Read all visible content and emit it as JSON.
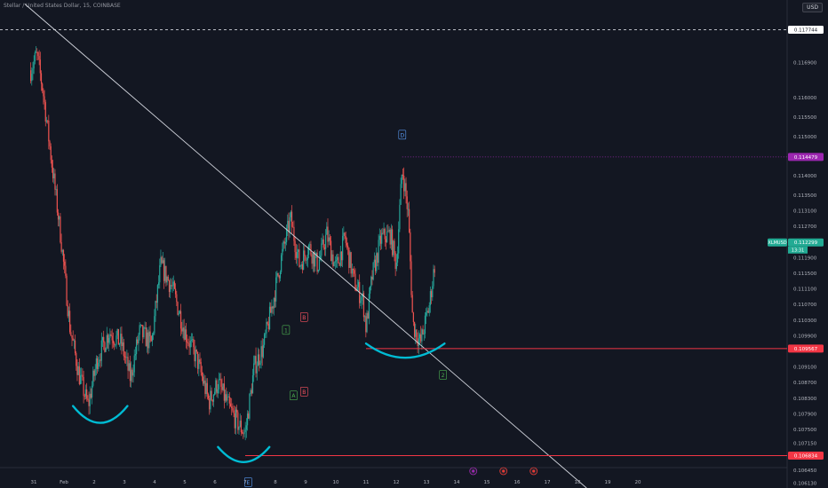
{
  "header": {
    "title": "Stellar / United States Dollar, 15, COINBASE",
    "currency": "USD"
  },
  "colors": {
    "background": "#131722",
    "up": "#26a69a",
    "down": "#ef5350",
    "trendline": "#d1d4dc",
    "support": "#f23645",
    "arc": "#00bcd4",
    "pivot_tag": "#9c27b0",
    "last_price_tag": "#22ab94"
  },
  "chart_data": {
    "type": "candlestick",
    "x": [
      "31",
      "Feb",
      "2",
      "3",
      "4",
      "5",
      "6",
      "7",
      "8",
      "9",
      "10",
      "11",
      "12",
      "13",
      "14",
      "15",
      "16",
      "17",
      "18",
      "19",
      "20"
    ],
    "ylim": [
      0.106,
      0.1185
    ],
    "y_ticks": [
      "0.117700",
      "0.116900",
      "0.116000",
      "0.115500",
      "0.115000",
      "0.114000",
      "0.113500",
      "0.113100",
      "0.112700",
      "0.111900",
      "0.111500",
      "0.111100",
      "0.110700",
      "0.110300",
      "0.109900",
      "0.109100",
      "0.108700",
      "0.108300",
      "0.107900",
      "0.107500",
      "0.107150",
      "0.106450",
      "0.106130"
    ],
    "y_tick_values": [
      0.1177,
      0.1169,
      0.116,
      0.1155,
      0.115,
      0.114,
      0.1135,
      0.1131,
      0.1127,
      0.1119,
      0.1115,
      0.1111,
      0.1107,
      0.1103,
      0.1099,
      0.1091,
      0.1087,
      0.1083,
      0.1079,
      0.1075,
      0.10715,
      0.10645,
      0.10613
    ],
    "price_path": [
      [
        30.9,
        0.1167
      ],
      [
        31.1,
        0.1171
      ],
      [
        31.3,
        0.1162
      ],
      [
        31.6,
        0.1143
      ],
      [
        31.9,
        0.1124
      ],
      [
        32.2,
        0.1101
      ],
      [
        32.5,
        0.1089
      ],
      [
        32.8,
        0.1081
      ],
      [
        33.1,
        0.1093
      ],
      [
        33.5,
        0.11
      ],
      [
        33.9,
        0.1097
      ],
      [
        34.2,
        0.1088
      ],
      [
        34.5,
        0.11
      ],
      [
        34.9,
        0.1097
      ],
      [
        35.2,
        0.1117
      ],
      [
        35.6,
        0.1111
      ],
      [
        36.0,
        0.11
      ],
      [
        36.4,
        0.1093
      ],
      [
        36.8,
        0.1082
      ],
      [
        37.1,
        0.1087
      ],
      [
        37.5,
        0.108
      ],
      [
        37.8,
        0.1076
      ],
      [
        38.0,
        0.1074
      ],
      [
        38.3,
        0.1091
      ],
      [
        38.6,
        0.1096
      ],
      [
        38.9,
        0.1107
      ],
      [
        39.2,
        0.1119
      ],
      [
        39.5,
        0.1129
      ],
      [
        39.8,
        0.1117
      ],
      [
        40.1,
        0.1122
      ],
      [
        40.4,
        0.1117
      ],
      [
        40.7,
        0.1125
      ],
      [
        41.0,
        0.1116
      ],
      [
        41.3,
        0.1124
      ],
      [
        41.6,
        0.1113
      ],
      [
        41.9,
        0.1108
      ],
      [
        42.0,
        0.1101
      ],
      [
        42.2,
        0.1114
      ],
      [
        42.5,
        0.1124
      ],
      [
        42.8,
        0.1125
      ],
      [
        43.0,
        0.1117
      ],
      [
        43.2,
        0.1142
      ],
      [
        43.4,
        0.113
      ],
      [
        43.55,
        0.1102
      ],
      [
        43.8,
        0.1097
      ],
      [
        44.1,
        0.1107
      ],
      [
        44.3,
        0.1119
      ]
    ],
    "last_price": 0.11229,
    "resistance_level": 0.11448,
    "support_levels": [
      0.10957,
      0.10683
    ],
    "dashed_level": 0.11774,
    "price_tags": [
      {
        "label": "0.117744",
        "value": 0.11774
      },
      {
        "label": "0.114479",
        "value": 0.11448
      },
      {
        "label": "0.112299",
        "value": 0.11229
      },
      {
        "label": "0.109567",
        "value": 0.10957
      },
      {
        "label": "0.106834",
        "value": 0.10683
      }
    ],
    "symbol_tag": "XLMUSD",
    "countdown": "13:31",
    "trendline": {
      "from": [
        30.7,
        0.1184
      ],
      "to": [
        49.3,
        0.106
      ]
    },
    "annotations": [
      {
        "text": "D",
        "x": 43.2,
        "y": 0.11505,
        "kind": "pivot"
      },
      {
        "text": "1",
        "x": 39.35,
        "y": 0.11005,
        "kind": "wave"
      },
      {
        "text": "B",
        "x": 39.95,
        "y": 0.11038,
        "kind": "wave_b"
      },
      {
        "text": "A",
        "x": 39.6,
        "y": 0.10837,
        "kind": "wave"
      },
      {
        "text": "B",
        "x": 39.95,
        "y": 0.10847,
        "kind": "wave_b"
      },
      {
        "text": "2",
        "x": 44.55,
        "y": 0.1089,
        "kind": "wave"
      },
      {
        "text": "E",
        "x": 38.1,
        "y": 0.10615,
        "kind": "pivot"
      }
    ],
    "grid": false
  }
}
